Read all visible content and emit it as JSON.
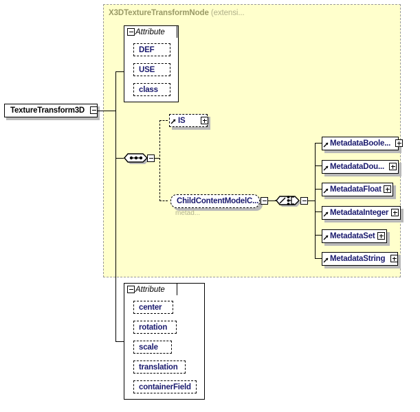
{
  "diagram": {
    "type": "xsd-schema-diagram",
    "root_element": {
      "label": "TextureTransform3D",
      "expander": "minus"
    },
    "extension_panel": {
      "title": "X3DTextureTransformNode",
      "title_suffix": "(extensi...",
      "background_color": "#ffffcc",
      "border_color": "#999999"
    },
    "inherited_attribute_group": {
      "tab_label": "Attribute",
      "tab_expander": "minus",
      "items": [
        {
          "label": "DEF"
        },
        {
          "label": "USE"
        },
        {
          "label": "class"
        }
      ]
    },
    "sequence_compositor": {
      "icon": "sequence-icon",
      "expander": "minus"
    },
    "optional_children": [
      {
        "label": "IS",
        "expander": "plus",
        "style": "dashed",
        "icon": "element-ref-arrow-icon"
      },
      {
        "label": "ChildContentModelC...",
        "sub_label": "metad...",
        "expander": "minus",
        "style": "rounded-dashed"
      }
    ],
    "choice_compositor": {
      "icon": "choice-icon",
      "expander": "minus"
    },
    "metadata_nodes": [
      {
        "label": "MetadataBoole...",
        "expander": "plus"
      },
      {
        "label": "MetadataDou...",
        "expander": "plus"
      },
      {
        "label": "MetadataFloat",
        "expander": "plus"
      },
      {
        "label": "MetadataInteger",
        "expander": "plus"
      },
      {
        "label": "MetadataSet",
        "expander": "plus"
      },
      {
        "label": "MetadataString",
        "expander": "plus"
      }
    ],
    "own_attribute_group": {
      "tab_label": "Attribute",
      "tab_expander": "minus",
      "items": [
        {
          "label": "center"
        },
        {
          "label": "rotation"
        },
        {
          "label": "scale"
        },
        {
          "label": "translation"
        },
        {
          "label": "containerField"
        }
      ]
    }
  }
}
